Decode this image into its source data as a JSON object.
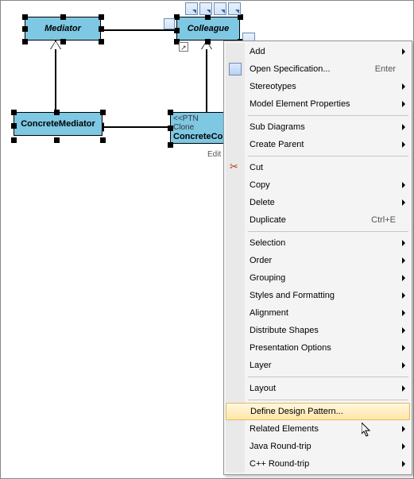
{
  "diagram": {
    "mediator": "Mediator",
    "colleague": "Colleague",
    "concreteMediator": "ConcreteMediator",
    "concreteColleague_stereo": "<<PTN Clone",
    "concreteColleague_name": "ConcreteCo"
  },
  "editLabel": "Edit",
  "menu": {
    "add": "Add",
    "openSpec": "Open Specification...",
    "openSpecKey": "Enter",
    "stereotypes": "Stereotypes",
    "modelElemProps": "Model Element Properties",
    "subDiagrams": "Sub Diagrams",
    "createParent": "Create Parent",
    "cut": "Cut",
    "copy": "Copy",
    "delete": "Delete",
    "duplicate": "Duplicate",
    "duplicateKey": "Ctrl+E",
    "selection": "Selection",
    "order": "Order",
    "grouping": "Grouping",
    "styles": "Styles and Formatting",
    "alignment": "Alignment",
    "distribute": "Distribute Shapes",
    "presentation": "Presentation Options",
    "layer": "Layer",
    "layout": "Layout",
    "definePattern": "Define Design Pattern...",
    "related": "Related Elements",
    "javaRT": "Java Round-trip",
    "cppRT": "C++ Round-trip"
  }
}
